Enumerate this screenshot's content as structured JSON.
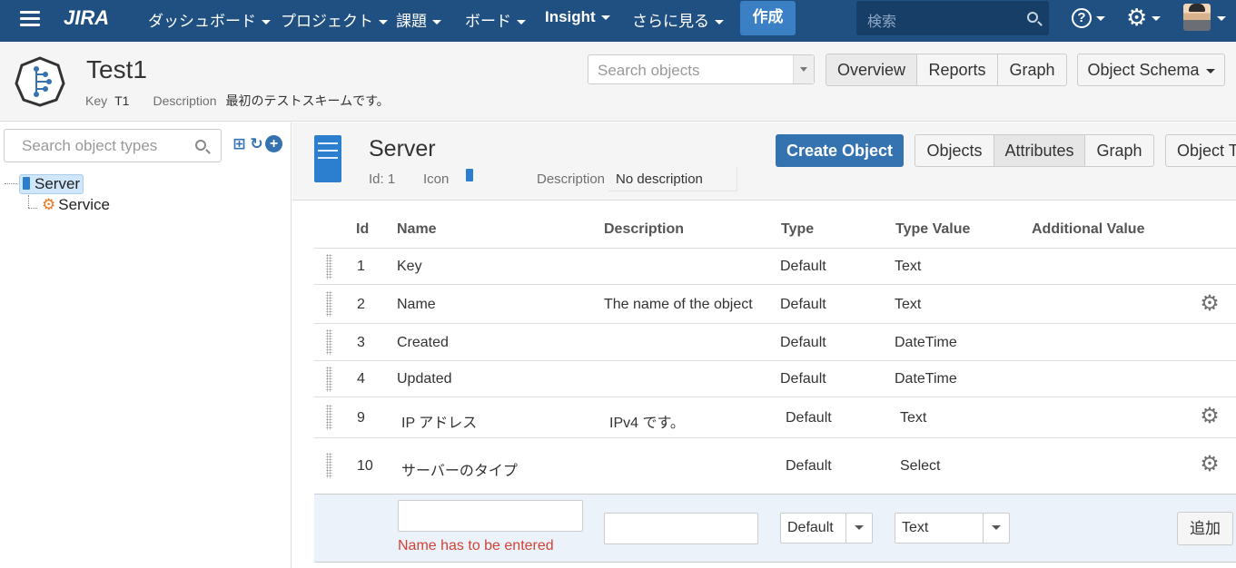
{
  "topnav": {
    "logo": "JIRA",
    "items": [
      "ダッシュボード",
      "プロジェクト",
      "課題",
      "ボード",
      "Insight",
      "さらに見る"
    ],
    "create": "作成",
    "search_placeholder": "検索",
    "help": "?"
  },
  "schema": {
    "title": "Test1",
    "key_label": "Key",
    "key_value": "T1",
    "description_label": "Description",
    "description_value": "最初のテストスキームです。",
    "search_placeholder": "Search objects",
    "tabs": [
      "Overview",
      "Reports",
      "Graph"
    ],
    "object_schema": "Object Schema"
  },
  "left": {
    "search_placeholder": "Search object types",
    "tree": [
      {
        "label": "Server",
        "selected": true
      },
      {
        "label": "Service",
        "selected": false
      }
    ]
  },
  "objtype": {
    "title": "Server",
    "id_label": "Id: 1",
    "icon_label": "Icon",
    "description_label": "Description",
    "description_value": "No description",
    "create_button": "Create Object",
    "tabs": [
      "Objects",
      "Attributes",
      "Graph",
      "Object T"
    ]
  },
  "table": {
    "headers": [
      "Id",
      "Name",
      "Description",
      "Type",
      "Type Value",
      "Additional Value"
    ],
    "rows": [
      {
        "id": "1",
        "name": "Key",
        "description": "",
        "type": "Default",
        "type_value": "Text",
        "gear": false
      },
      {
        "id": "2",
        "name": "Name",
        "description": "The name of the object",
        "type": "Default",
        "type_value": "Text",
        "gear": true
      },
      {
        "id": "3",
        "name": "Created",
        "description": "",
        "type": "Default",
        "type_value": "DateTime",
        "gear": false
      },
      {
        "id": "4",
        "name": "Updated",
        "description": "",
        "type": "Default",
        "type_value": "DateTime",
        "gear": false
      },
      {
        "id": "9",
        "name": "IP アドレス",
        "description": "IPv4 です。",
        "type": "Default",
        "type_value": "Text",
        "gear": true
      },
      {
        "id": "10",
        "name": "サーバーのタイプ",
        "description": "",
        "type": "Default",
        "type_value": "Select",
        "gear": true
      }
    ],
    "add_row": {
      "name_value": "",
      "description_value": "",
      "type_selected": "Default",
      "type_value_selected": "Text",
      "error": "Name has to be entered",
      "add_button": "追加"
    }
  },
  "colors": {
    "nav_bg": "#205081",
    "primary": "#3572b0",
    "error": "#d04437",
    "add_row_bg": "#ebf2f9"
  }
}
